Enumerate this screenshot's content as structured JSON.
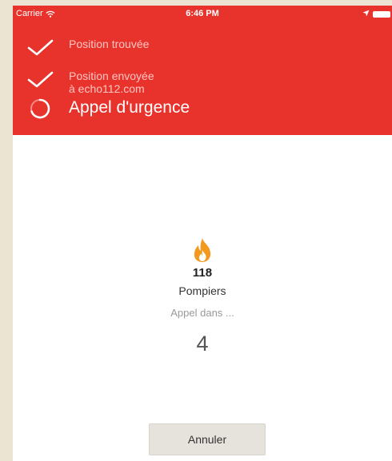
{
  "status_bar": {
    "carrier": "Carrier",
    "time": "6:46 PM",
    "icons": [
      "wifi-icon",
      "location-arrow-icon",
      "battery-icon"
    ]
  },
  "steps": [
    {
      "label": "Position trouvée",
      "state": "done",
      "icon": "checkmark-icon"
    },
    {
      "label": "Position envoyée\nà echo112.com",
      "state": "done",
      "icon": "checkmark-icon"
    },
    {
      "label": "Appel d'urgence",
      "state": "in-progress",
      "icon": "spinner-icon"
    }
  ],
  "service": {
    "icon": "fire-icon",
    "number": "118",
    "name": "Pompiers"
  },
  "call": {
    "label": "Appel dans ...",
    "countdown": "4"
  },
  "cancel_label": "Annuler",
  "colors": {
    "header_red": "#e8332d",
    "fire_orange": "#f39a1e",
    "page_background": "#ece4d2"
  }
}
